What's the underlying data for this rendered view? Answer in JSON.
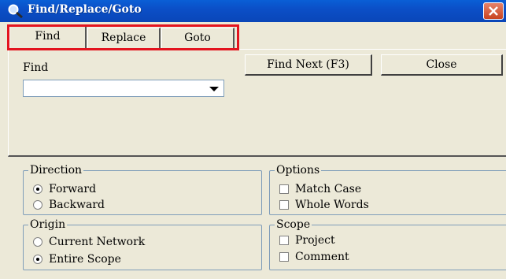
{
  "window": {
    "title": "Find/Replace/Goto"
  },
  "tabs": [
    {
      "label": "Find",
      "active": true
    },
    {
      "label": "Replace",
      "active": false
    },
    {
      "label": "Goto",
      "active": false
    }
  ],
  "find": {
    "label": "Find",
    "value": "",
    "find_next_label": "Find Next (F3)",
    "close_label": "Close"
  },
  "direction": {
    "title": "Direction",
    "options": [
      {
        "label": "Forward",
        "selected": true
      },
      {
        "label": "Backward",
        "selected": false
      }
    ]
  },
  "options": {
    "title": "Options",
    "items": [
      {
        "label": "Match Case",
        "checked": false
      },
      {
        "label": "Whole Words",
        "checked": false
      }
    ]
  },
  "origin": {
    "title": "Origin",
    "options": [
      {
        "label": "Current Network",
        "selected": false
      },
      {
        "label": "Entire Scope",
        "selected": true
      }
    ]
  },
  "scope": {
    "title": "Scope",
    "items": [
      {
        "label": "Project",
        "checked": false
      },
      {
        "label": "Comment",
        "checked": false
      }
    ]
  },
  "colors": {
    "titlebar": "#0a5fd6",
    "highlight": "#e3141f",
    "face": "#ece9d8"
  }
}
